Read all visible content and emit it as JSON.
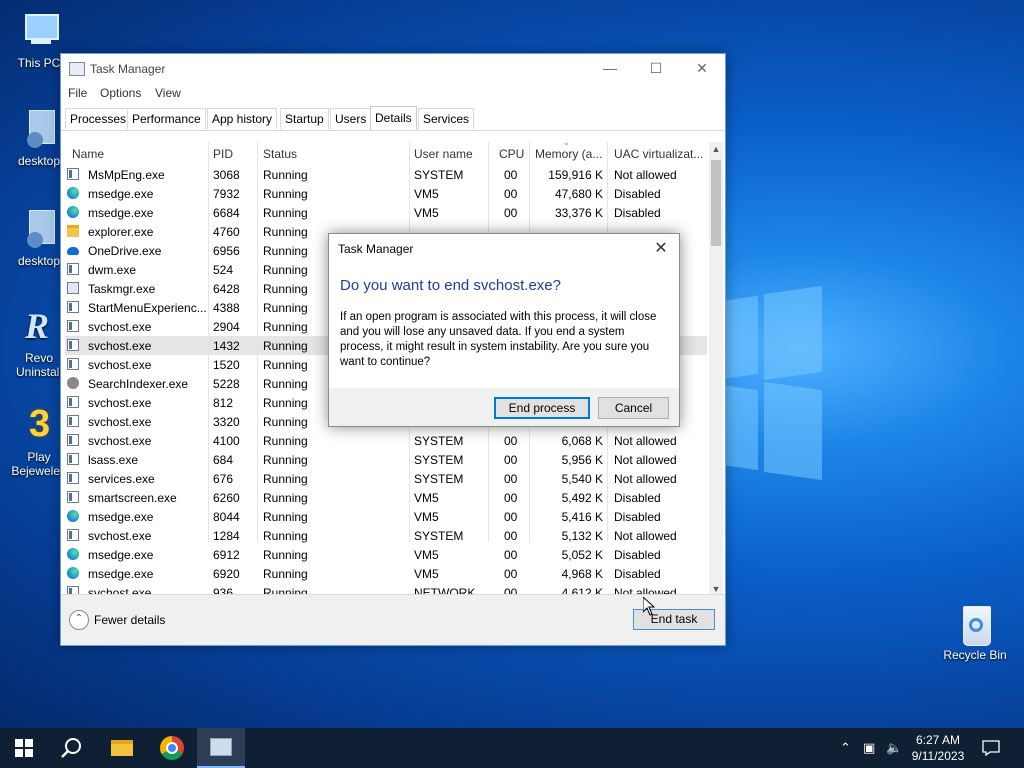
{
  "desktop": {
    "icons": [
      {
        "label": "This PC"
      },
      {
        "label": "desktop"
      },
      {
        "label": "desktop"
      },
      {
        "label": "Revo Uninstall"
      },
      {
        "label": "Play Bejeweled"
      },
      {
        "label": "Recycle Bin"
      }
    ]
  },
  "taskmanager": {
    "title": "Task Manager",
    "menu": [
      "File",
      "Options",
      "View"
    ],
    "tabs": [
      "Processes",
      "Performance",
      "App history",
      "Startup",
      "Users",
      "Details",
      "Services"
    ],
    "active_tab": "Details",
    "columns": [
      "Name",
      "PID",
      "Status",
      "User name",
      "CPU",
      "Memory (a...",
      "UAC virtualizat..."
    ],
    "rows": [
      {
        "icon": "exe",
        "name": "MsMpEng.exe",
        "pid": "3068",
        "status": "Running",
        "user": "SYSTEM",
        "cpu": "00",
        "mem": "159,916 K",
        "uac": "Not allowed"
      },
      {
        "icon": "edge",
        "name": "msedge.exe",
        "pid": "7932",
        "status": "Running",
        "user": "VM5",
        "cpu": "00",
        "mem": "47,680 K",
        "uac": "Disabled"
      },
      {
        "icon": "edge",
        "name": "msedge.exe",
        "pid": "6684",
        "status": "Running",
        "user": "VM5",
        "cpu": "00",
        "mem": "33,376 K",
        "uac": "Disabled"
      },
      {
        "icon": "folder",
        "name": "explorer.exe",
        "pid": "4760",
        "status": "Running",
        "user": "",
        "cpu": "",
        "mem": "",
        "uac": ""
      },
      {
        "icon": "cloud",
        "name": "OneDrive.exe",
        "pid": "6956",
        "status": "Running",
        "user": "",
        "cpu": "",
        "mem": "",
        "uac": ""
      },
      {
        "icon": "exe",
        "name": "dwm.exe",
        "pid": "524",
        "status": "Running",
        "user": "",
        "cpu": "",
        "mem": "",
        "uac": ""
      },
      {
        "icon": "tm",
        "name": "Taskmgr.exe",
        "pid": "6428",
        "status": "Running",
        "user": "",
        "cpu": "",
        "mem": "",
        "uac": ""
      },
      {
        "icon": "exe",
        "name": "StartMenuExperienc...",
        "pid": "4388",
        "status": "Running",
        "user": "",
        "cpu": "",
        "mem": "",
        "uac": ""
      },
      {
        "icon": "exe",
        "name": "svchost.exe",
        "pid": "2904",
        "status": "Running",
        "user": "",
        "cpu": "",
        "mem": "",
        "uac": ""
      },
      {
        "icon": "exe",
        "name": "svchost.exe",
        "pid": "1432",
        "status": "Running",
        "user": "",
        "cpu": "",
        "mem": "",
        "uac": "",
        "selected": true
      },
      {
        "icon": "exe",
        "name": "svchost.exe",
        "pid": "1520",
        "status": "Running",
        "user": "",
        "cpu": "",
        "mem": "",
        "uac": ""
      },
      {
        "icon": "search",
        "name": "SearchIndexer.exe",
        "pid": "5228",
        "status": "Running",
        "user": "",
        "cpu": "",
        "mem": "",
        "uac": ""
      },
      {
        "icon": "exe",
        "name": "svchost.exe",
        "pid": "812",
        "status": "Running",
        "user": "",
        "cpu": "",
        "mem": "",
        "uac": ""
      },
      {
        "icon": "exe",
        "name": "svchost.exe",
        "pid": "3320",
        "status": "Running",
        "user": "",
        "cpu": "",
        "mem": "",
        "uac": ""
      },
      {
        "icon": "exe",
        "name": "svchost.exe",
        "pid": "4100",
        "status": "Running",
        "user": "SYSTEM",
        "cpu": "00",
        "mem": "6,068 K",
        "uac": "Not allowed"
      },
      {
        "icon": "exe",
        "name": "lsass.exe",
        "pid": "684",
        "status": "Running",
        "user": "SYSTEM",
        "cpu": "00",
        "mem": "5,956 K",
        "uac": "Not allowed"
      },
      {
        "icon": "exe",
        "name": "services.exe",
        "pid": "676",
        "status": "Running",
        "user": "SYSTEM",
        "cpu": "00",
        "mem": "5,540 K",
        "uac": "Not allowed"
      },
      {
        "icon": "exe",
        "name": "smartscreen.exe",
        "pid": "6260",
        "status": "Running",
        "user": "VM5",
        "cpu": "00",
        "mem": "5,492 K",
        "uac": "Disabled"
      },
      {
        "icon": "edge",
        "name": "msedge.exe",
        "pid": "8044",
        "status": "Running",
        "user": "VM5",
        "cpu": "00",
        "mem": "5,416 K",
        "uac": "Disabled"
      },
      {
        "icon": "exe",
        "name": "svchost.exe",
        "pid": "1284",
        "status": "Running",
        "user": "SYSTEM",
        "cpu": "00",
        "mem": "5,132 K",
        "uac": "Not allowed"
      },
      {
        "icon": "edge",
        "name": "msedge.exe",
        "pid": "6912",
        "status": "Running",
        "user": "VM5",
        "cpu": "00",
        "mem": "5,052 K",
        "uac": "Disabled"
      },
      {
        "icon": "edge",
        "name": "msedge.exe",
        "pid": "6920",
        "status": "Running",
        "user": "VM5",
        "cpu": "00",
        "mem": "4,968 K",
        "uac": "Disabled"
      },
      {
        "icon": "exe",
        "name": "svchost.exe",
        "pid": "936",
        "status": "Running",
        "user": "NETWORK",
        "cpu": "00",
        "mem": "4,612 K",
        "uac": "Not allowed"
      }
    ],
    "fewer_details": "Fewer details",
    "end_task": "End task"
  },
  "dialog": {
    "title": "Task Manager",
    "question": "Do you want to end svchost.exe?",
    "message": "If an open program is associated with this process, it will close and you will lose any unsaved data. If you end a system process, it might result in system instability. Are you sure you want to continue?",
    "primary": "End process",
    "cancel": "Cancel"
  },
  "taskbar": {
    "time": "6:27 AM",
    "date": "9/11/2023"
  }
}
